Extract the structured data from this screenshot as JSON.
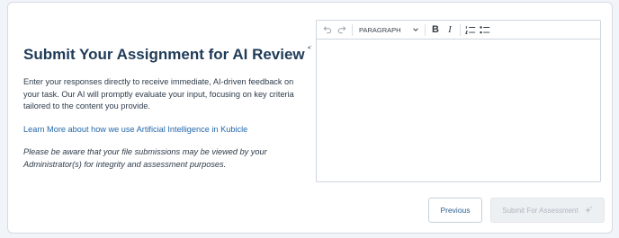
{
  "assignment": {
    "title": "Submit Your Assignment for AI Review",
    "intro": "Enter your responses directly to receive immediate, AI-driven feedback on your task. Our AI will promptly evaluate your input, focusing on key criteria tailored to the content you provide.",
    "learn_more_link": "Learn More about how we use Artificial Intelligence in Kubicle",
    "notice": "Please be aware that your file submissions may be viewed by your Administrator(s) for integrity and assessment purposes."
  },
  "editor": {
    "block_type": "PARAGRAPH",
    "bold_label": "B",
    "italic_label": "I",
    "content": ""
  },
  "actions": {
    "previous_label": "Previous",
    "submit_label": "Submit For Assessment"
  },
  "colors": {
    "title": "#1f3b57",
    "link": "#2368a8",
    "accent": "#1f3b57",
    "disabled": "#aeb6bf"
  }
}
